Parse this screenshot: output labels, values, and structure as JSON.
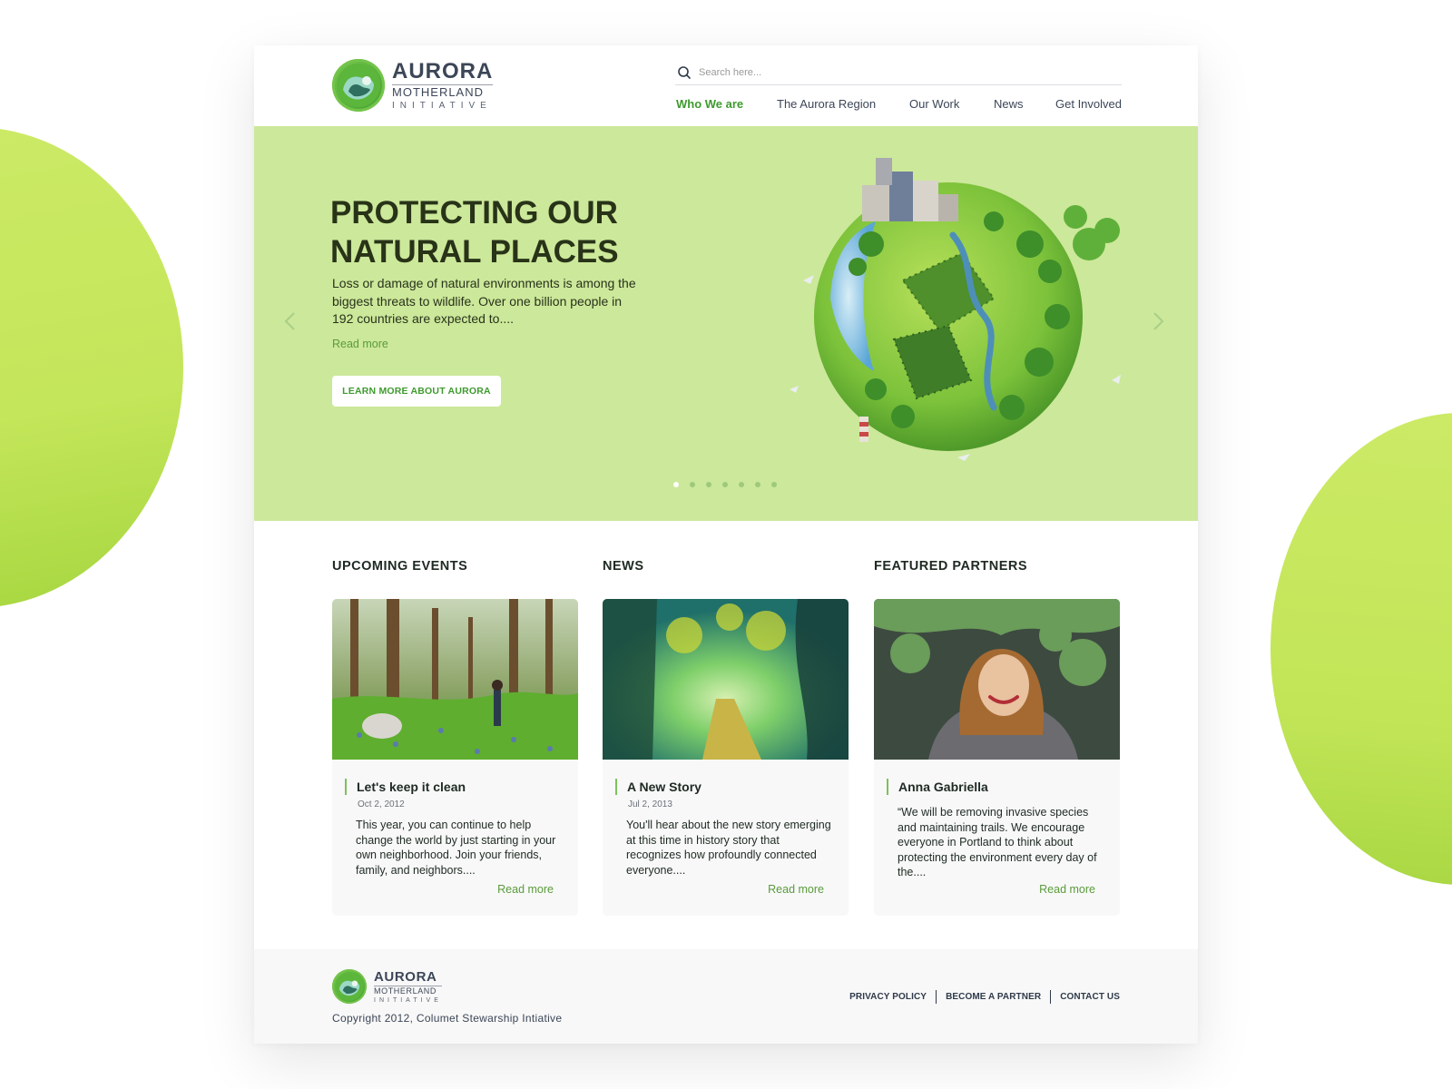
{
  "brand": {
    "name": "AURORA",
    "subtitle": "MOTHERLAND",
    "tagline": "INITIATIVE"
  },
  "search": {
    "placeholder": "Search here..."
  },
  "nav": {
    "items": [
      {
        "label": "Who We are",
        "active": true
      },
      {
        "label": "The Aurora Region",
        "active": false
      },
      {
        "label": "Our Work",
        "active": false
      },
      {
        "label": "News",
        "active": false
      },
      {
        "label": "Get Involved",
        "active": false
      }
    ]
  },
  "hero": {
    "title_line1": "PROTECTING OUR",
    "title_line2": "NATURAL PLACES",
    "lead": "Loss or damage of natural environments is among the biggest threats to wildlife. Over one billion people in 192 countries are expected to....",
    "read_more": "Read more",
    "cta": "LEARN MORE ABOUT AURORA",
    "slide_count": 7,
    "active_slide": 1
  },
  "sections": {
    "events": "UPCOMING EVENTS",
    "news": "NEWS",
    "partners": "FEATURED PARTNERS"
  },
  "cards": [
    {
      "title": "Let's keep it clean",
      "date": "Oct 2, 2012",
      "text": "This year, you can continue to help change the world by just starting in your own neighborhood. Join your friends, family, and neighbors....",
      "more": "Read more"
    },
    {
      "title": "A New Story",
      "date": "Jul 2, 2013",
      "text": "You'll hear about the new story emerging at this time in history story that recognizes how profoundly connected everyone....",
      "more": "Read more"
    },
    {
      "title": "Anna Gabriella",
      "text": "“We will be removing invasive species and maintaining trails. We encourage everyone in Portland to think about protecting the environment every day of the....",
      "more": "Read more"
    }
  ],
  "footer": {
    "copyright": "Copyright 2012, Columet Stewarship Intiative",
    "links": [
      "PRIVACY POLICY",
      "BECOME A PARTNER",
      "CONTACT US"
    ]
  },
  "colors": {
    "accent": "#3e9a2e",
    "hero_bg": "#cce89a",
    "blob": "#c4e65a",
    "text_dark": "#1e2a22",
    "link_green": "#5a9b3c"
  }
}
